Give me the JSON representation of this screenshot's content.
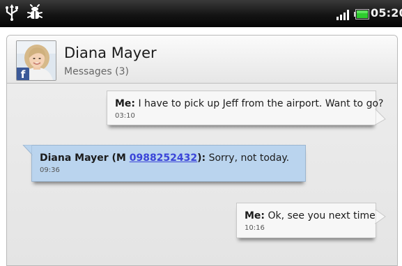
{
  "status_bar": {
    "time": "05:20",
    "icons": [
      "usb-icon",
      "debug-bug-icon",
      "signal-icon",
      "battery-icon"
    ],
    "battery_color": "#2ecc2e"
  },
  "contact": {
    "name": "Diana Mayer",
    "subtitle": "Messages (3)",
    "badge": "f",
    "badge_color": "#3b5998"
  },
  "messages": [
    {
      "direction": "outgoing",
      "sender": "Me:",
      "text": " I have to pick up Jeff from the airport. Want to go?",
      "time": "03:10"
    },
    {
      "direction": "incoming",
      "sender_prefix": "Diana Mayer (M ",
      "phone": "0988252432",
      "sender_suffix": "):",
      "text": " Sorry, not today.",
      "time": "09:36"
    },
    {
      "direction": "outgoing",
      "sender": "Me:",
      "text": " Ok, see you next time.",
      "time": "10:16"
    }
  ],
  "colors": {
    "incoming_bubble": "#bad4ee",
    "outgoing_bubble": "#f7f7f7",
    "link": "#3a44d8"
  }
}
